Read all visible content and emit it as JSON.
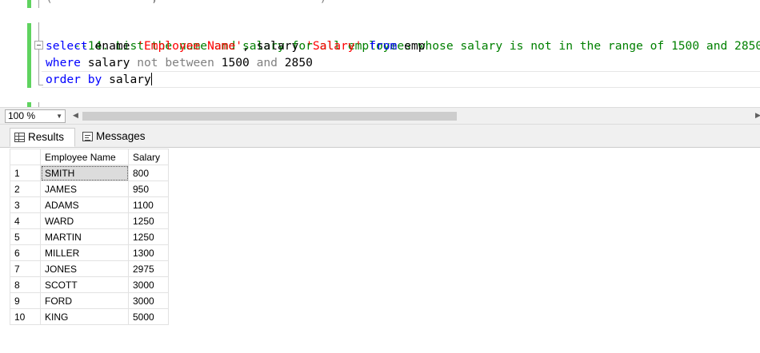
{
  "editor": {
    "partial_top_line": "(              ,                       )",
    "lines": [
      {
        "comment": "--14. List the name and salary for all employees whose salary is not in the range of 1500 and 2850."
      },
      {
        "kw1": "select",
        "t1": " ename ",
        "s1": "'Employee Name'",
        "t2": ", salary ",
        "s2": "'Salary'",
        "t3": " ",
        "kw2": "from",
        "t4": " emp"
      },
      {
        "kw1": "where",
        "t1": " salary ",
        "g1": "not between",
        "t2": " 1500 ",
        "g2": "and",
        "t3": " 2850"
      },
      {
        "kw1": "order by",
        "t1": " salary"
      }
    ]
  },
  "zoom": {
    "value": "100 %"
  },
  "tabs": {
    "results": "Results",
    "messages": "Messages"
  },
  "results": {
    "columns": [
      "Employee Name",
      "Salary"
    ],
    "rows": [
      {
        "n": "1",
        "name": "SMITH",
        "salary": "800"
      },
      {
        "n": "2",
        "name": "JAMES",
        "salary": "950"
      },
      {
        "n": "3",
        "name": "ADAMS",
        "salary": "1100"
      },
      {
        "n": "4",
        "name": "WARD",
        "salary": "1250"
      },
      {
        "n": "5",
        "name": "MARTIN",
        "salary": "1250"
      },
      {
        "n": "6",
        "name": "MILLER",
        "salary": "1300"
      },
      {
        "n": "7",
        "name": "JONES",
        "salary": "2975"
      },
      {
        "n": "8",
        "name": "SCOTT",
        "salary": "3000"
      },
      {
        "n": "9",
        "name": "FORD",
        "salary": "3000"
      },
      {
        "n": "10",
        "name": "KING",
        "salary": "5000"
      }
    ]
  }
}
